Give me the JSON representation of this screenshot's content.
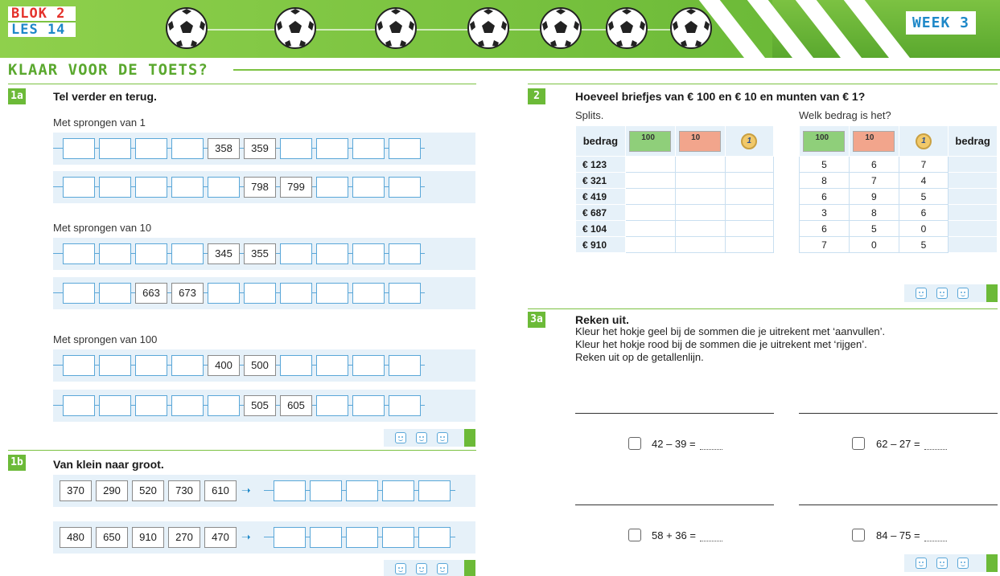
{
  "header": {
    "blok": "BLOK 2",
    "les": "LES 14",
    "week": "WEEK 3",
    "page_title": "KLAAR VOOR DE TOETS?"
  },
  "ex1a": {
    "number": "1a",
    "title": "Tel verder en terug.",
    "groups": [
      {
        "label": "Met sprongen van 1",
        "rows": [
          [
            "",
            "",
            "",
            "",
            "358",
            "359",
            "",
            "",
            "",
            ""
          ],
          [
            "",
            "",
            "",
            "",
            "",
            "798",
            "799",
            "",
            "",
            ""
          ]
        ]
      },
      {
        "label": "Met sprongen van 10",
        "rows": [
          [
            "",
            "",
            "",
            "",
            "345",
            "355",
            "",
            "",
            "",
            ""
          ],
          [
            "",
            "",
            "663",
            "673",
            "",
            "",
            "",
            "",
            "",
            ""
          ]
        ]
      },
      {
        "label": "Met sprongen van 100",
        "rows": [
          [
            "",
            "",
            "",
            "",
            "400",
            "500",
            "",
            "",
            "",
            ""
          ],
          [
            "",
            "",
            "",
            "",
            "",
            "505",
            "605",
            "",
            "",
            ""
          ]
        ]
      }
    ]
  },
  "ex1b": {
    "number": "1b",
    "title": "Van klein naar groot.",
    "rows": [
      [
        "370",
        "290",
        "520",
        "730",
        "610"
      ],
      [
        "480",
        "650",
        "910",
        "270",
        "470"
      ]
    ]
  },
  "ex2": {
    "number": "2",
    "title": "Hoeveel briefjes van € 100 en € 10 en munten van € 1?",
    "left_sub": "Splits.",
    "right_sub": "Welk bedrag is het?",
    "col_bedrag": "bedrag",
    "note100": "100",
    "note10": "10",
    "coin": "1",
    "left_rows": [
      "€ 123",
      "€ 321",
      "€ 419",
      "€ 687",
      "€ 104",
      "€ 910"
    ],
    "right_rows": [
      [
        "5",
        "6",
        "7"
      ],
      [
        "8",
        "7",
        "4"
      ],
      [
        "6",
        "9",
        "5"
      ],
      [
        "3",
        "8",
        "6"
      ],
      [
        "6",
        "5",
        "0"
      ],
      [
        "7",
        "0",
        "5"
      ]
    ]
  },
  "ex3a": {
    "number": "3a",
    "title": "Reken uit.",
    "instructions": [
      "Kleur het hokje geel bij de sommen die je uitrekent met ‘aanvullen’.",
      "Kleur het hokje rood bij de sommen die je uitrekent met ‘rijgen’.",
      "Reken uit op de getallenlijn."
    ],
    "sums": [
      "42 – 39 =",
      "62 – 27 =",
      "58 + 36 =",
      "84 – 75 ="
    ]
  },
  "colors": {
    "green": "#6cba38",
    "blue": "#1e88c8",
    "light_blue": "#e6f1f9",
    "red": "#e4312b"
  },
  "icons": {
    "ball": "soccer-ball-icon",
    "smiley": "smiley-icon",
    "arrow": "arrow-right-icon"
  }
}
